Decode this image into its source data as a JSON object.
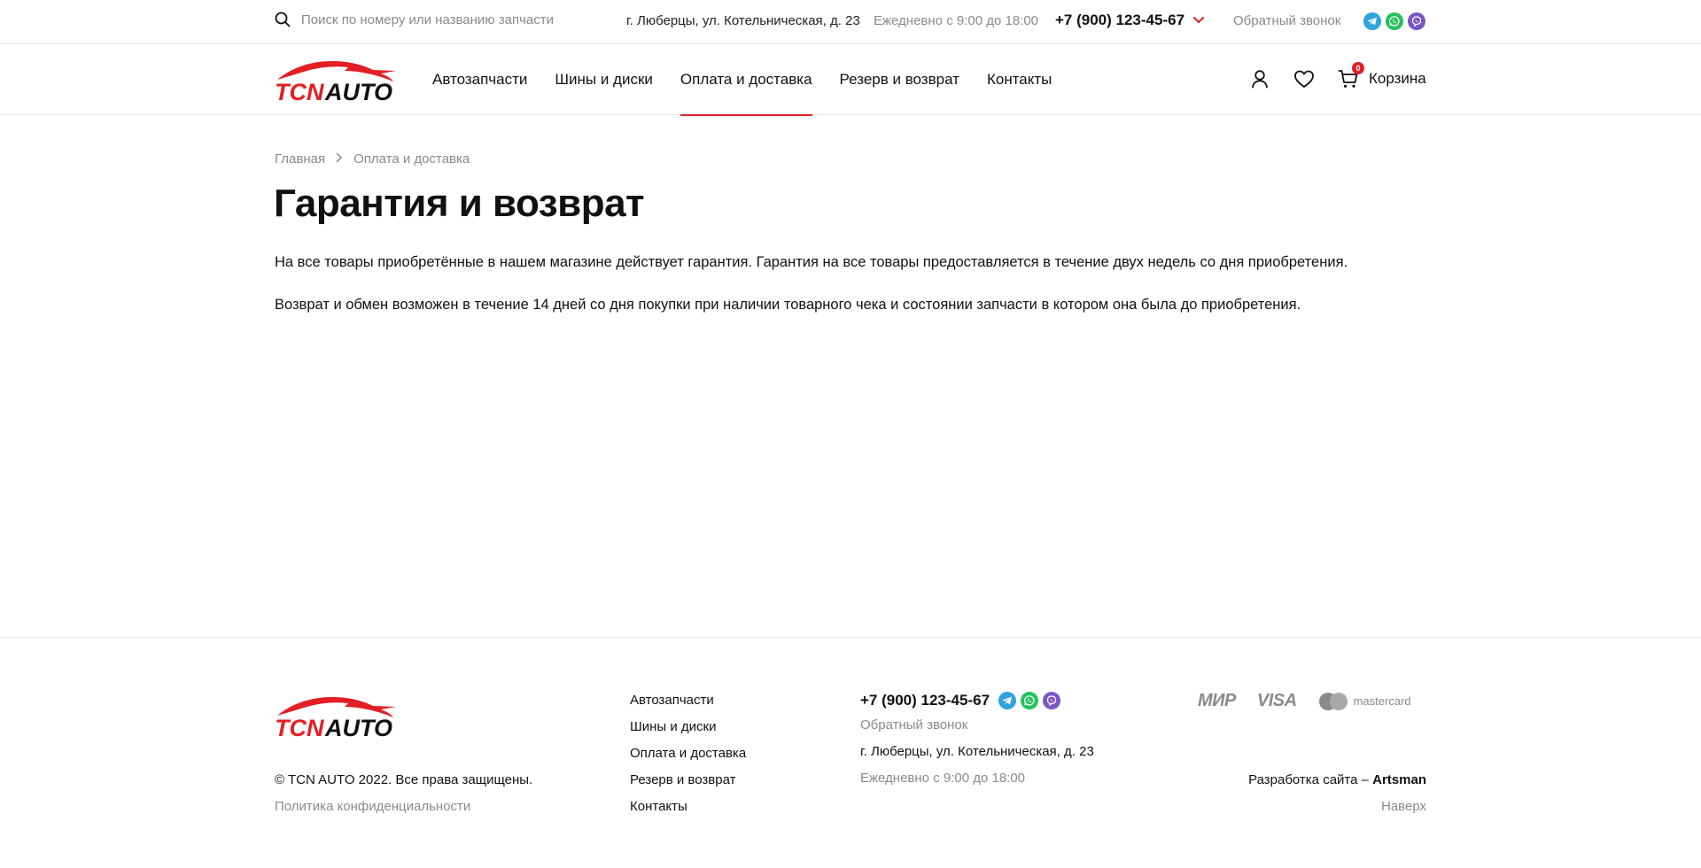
{
  "colors": {
    "accent": "#e31e24",
    "text": "#111111",
    "muted": "#8a8a8a",
    "telegram": "#2fa3dc",
    "whatsapp": "#25c25a",
    "viber": "#7b56c4"
  },
  "topbar": {
    "search_placeholder": "Поиск по номеру или названию запчасти",
    "address": "г. Люберцы, ул. Котельническая, д. 23",
    "hours": "Ежедневно с 9:00 до 18:00",
    "phone": "+7 (900) 123-45-67",
    "callback": "Обратный звонок",
    "messengers": [
      "telegram-icon",
      "whatsapp-icon",
      "viber-icon"
    ]
  },
  "logo": {
    "text_tcn": "TCN",
    "text_auto": "AUTO"
  },
  "nav": {
    "items": [
      {
        "label": "Автозапчасти"
      },
      {
        "label": "Шины и диски"
      },
      {
        "label": "Оплата и доставка",
        "active": true
      },
      {
        "label": "Резерв и возврат"
      },
      {
        "label": "Контакты"
      }
    ]
  },
  "header_icons": [
    "user-icon",
    "heart-icon",
    "cart-icon"
  ],
  "cart": {
    "label": "Корзина",
    "count": "0"
  },
  "breadcrumb": {
    "home": "Главная",
    "current": "Оплата и доставка"
  },
  "main": {
    "title": "Гарантия и возврат",
    "paragraphs": [
      "На все товары приобретённые в нашем магазине действует гарантия. Гарантия на все товары предоставляется в течение двух недель со дня приобретения.",
      "Возврат и обмен возможен в течение 14 дней со дня покупки при наличии товарного чека и состоянии запчасти в котором она была до приобретения."
    ]
  },
  "footer": {
    "copyright": "© TCN AUTO 2022. Все права защищены.",
    "privacy": "Политика конфиденциальности",
    "links": [
      "Автозапчасти",
      "Шины и диски",
      "Оплата и доставка",
      "Резерв и возврат",
      "Контакты"
    ],
    "phone": "+7 (900) 123-45-67",
    "callback": "Обратный звонок",
    "address": "г. Люберцы, ул. Котельническая, д. 23",
    "hours": "Ежедневно с 9:00 до 18:00",
    "payments": {
      "mir": "МИР",
      "visa": "VISA",
      "mastercard": "mastercard"
    },
    "dev_prefix": "Разработка сайта – ",
    "dev_name": "Artsman",
    "to_top": "Наверх"
  }
}
